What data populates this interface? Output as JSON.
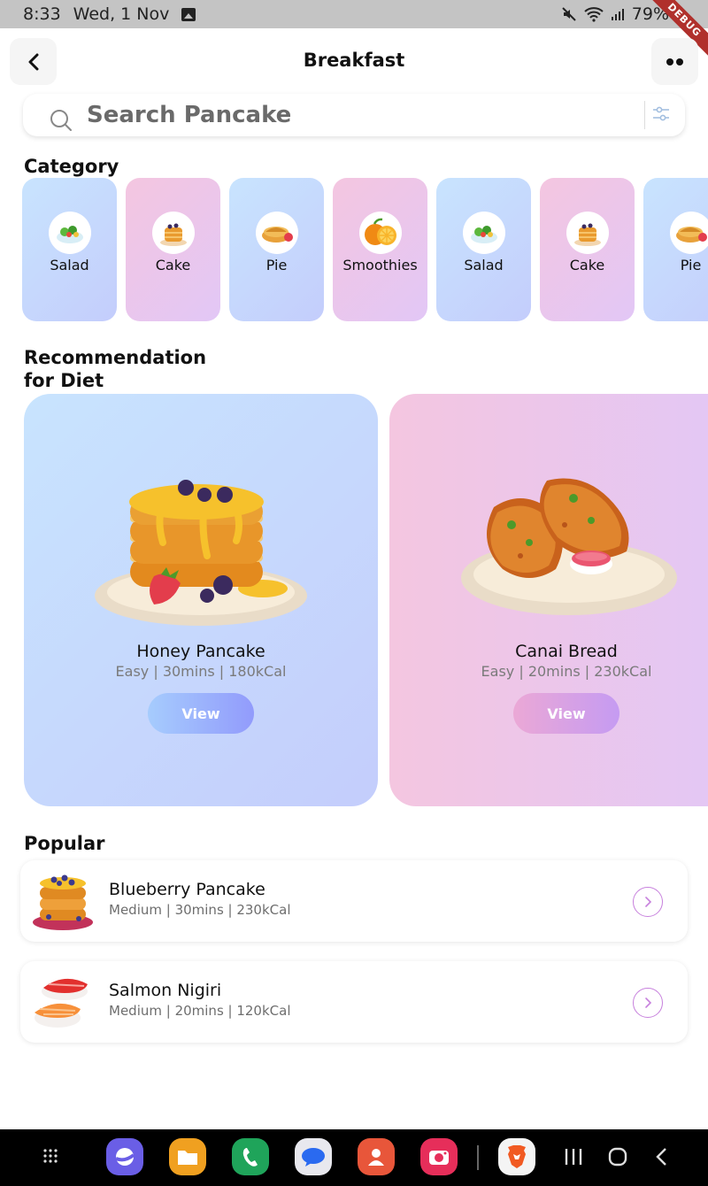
{
  "status_bar": {
    "time": "8:33",
    "date": "Wed, 1 Nov",
    "battery": "79%",
    "debug_label": "DEBUG"
  },
  "header": {
    "title": "Breakfast"
  },
  "search": {
    "placeholder": "Search Pancake"
  },
  "categories": {
    "title": "Category",
    "items": [
      {
        "label": "Salad",
        "icon": "salad-icon"
      },
      {
        "label": "Cake",
        "icon": "cake-icon"
      },
      {
        "label": "Pie",
        "icon": "pie-icon"
      },
      {
        "label": "Smoothies",
        "icon": "orange-icon"
      },
      {
        "label": "Salad",
        "icon": "salad-icon"
      },
      {
        "label": "Cake",
        "icon": "cake-icon"
      },
      {
        "label": "Pie",
        "icon": "pie-icon"
      }
    ]
  },
  "recommendations": {
    "title_line1": "Recommendation",
    "title_line2": "for Diet",
    "items": [
      {
        "name": "Honey Pancake",
        "meta": "Easy | 30mins | 180kCal",
        "button": "View",
        "accent": "#929bfc"
      },
      {
        "name": "Canai Bread",
        "meta": "Easy | 20mins | 230kCal",
        "button": "View",
        "accent": "#c59bf2"
      }
    ]
  },
  "popular": {
    "title": "Popular",
    "items": [
      {
        "name": "Blueberry Pancake",
        "meta": "Medium | 30mins | 230kCal"
      },
      {
        "name": "Salmon Nigiri",
        "meta": "Medium | 20mins | 120kCal"
      }
    ]
  }
}
